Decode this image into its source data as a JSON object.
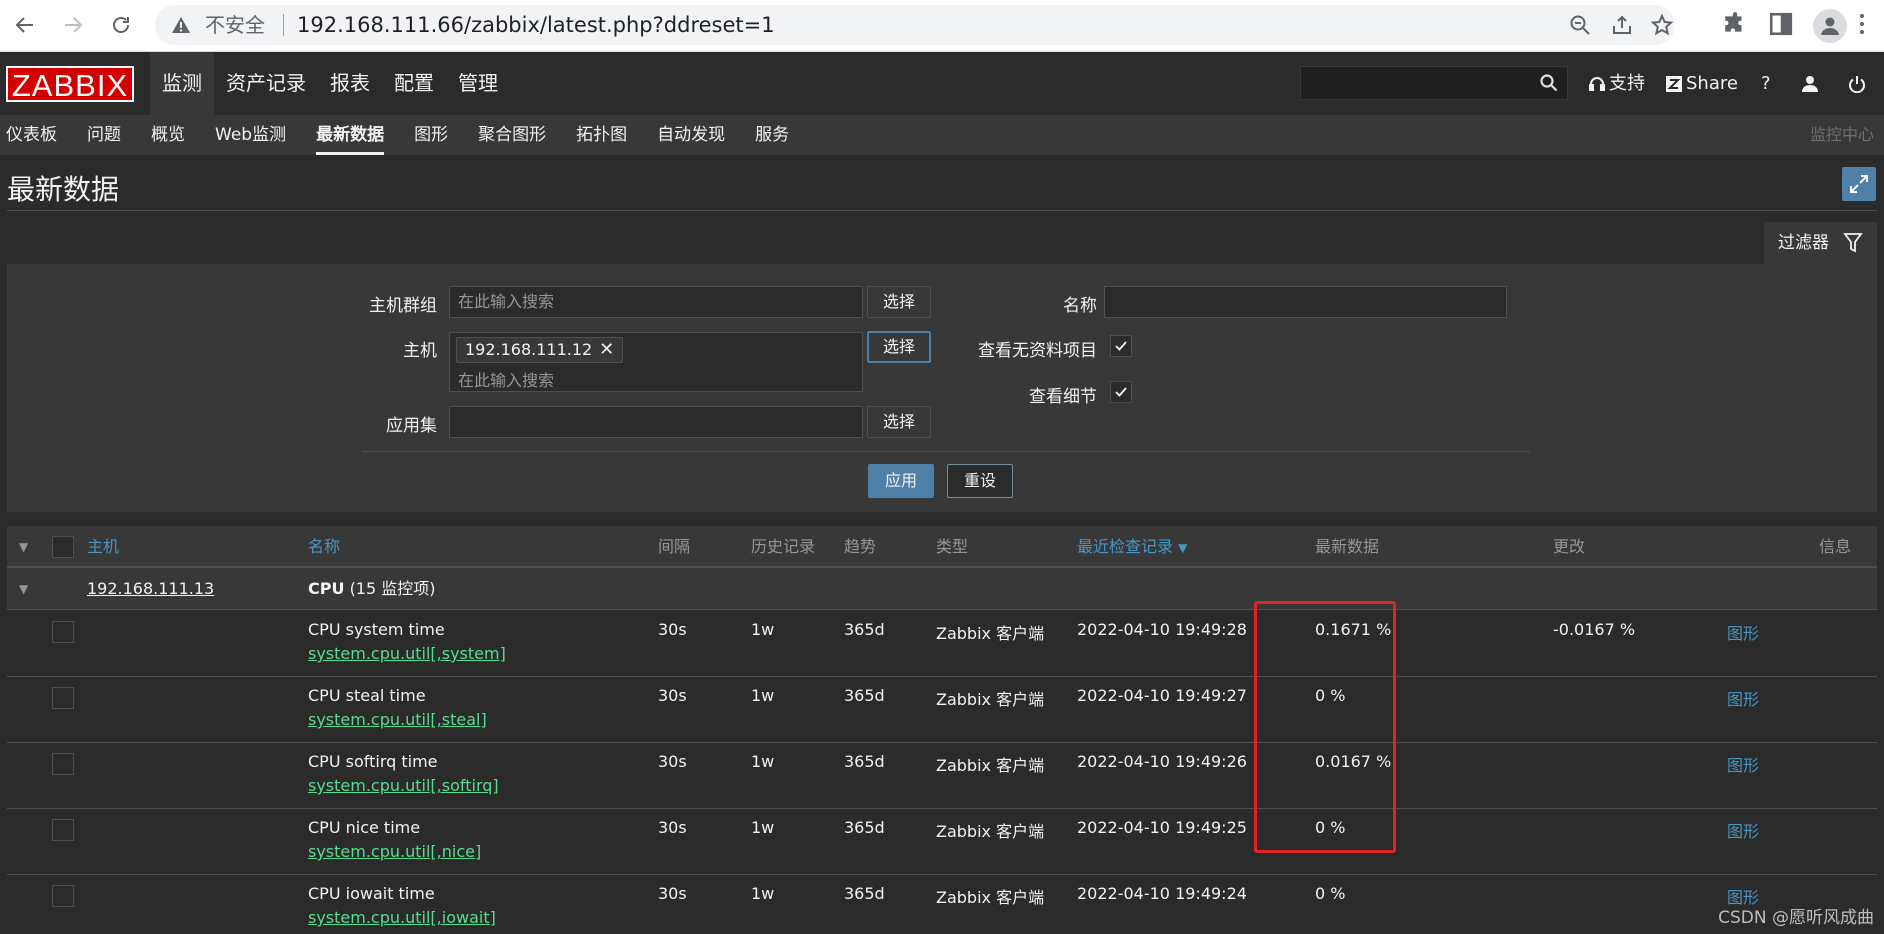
{
  "browser": {
    "insecure_label": "不安全",
    "url": "192.168.111.66/zabbix/latest.php?ddreset=1"
  },
  "topnav": {
    "logo": "ZABBIX",
    "menu": [
      {
        "label": "监测",
        "active": true
      },
      {
        "label": "资产记录"
      },
      {
        "label": "报表"
      },
      {
        "label": "配置"
      },
      {
        "label": "管理"
      }
    ],
    "support_label": "支持",
    "share_label": "Share",
    "help_label": "?"
  },
  "subnav": {
    "items": [
      {
        "label": "仪表板"
      },
      {
        "label": "问题"
      },
      {
        "label": "概览"
      },
      {
        "label": "Web监测"
      },
      {
        "label": "最新数据",
        "active": true
      },
      {
        "label": "图形"
      },
      {
        "label": "聚合图形"
      },
      {
        "label": "拓扑图"
      },
      {
        "label": "自动发现"
      },
      {
        "label": "服务"
      }
    ],
    "right_label": "监控中心"
  },
  "page": {
    "title": "最新数据"
  },
  "filter": {
    "tab_label": "过滤器",
    "host_group_label": "主机群组",
    "host_group_placeholder": "在此输入搜索",
    "host_label": "主机",
    "host_chip": "192.168.111.12",
    "host_placeholder": "在此输入搜索",
    "application_label": "应用集",
    "name_label": "名称",
    "show_no_data_label": "查看无资料项目",
    "show_details_label": "查看细节",
    "select_label": "选择",
    "apply_label": "应用",
    "reset_label": "重设"
  },
  "table": {
    "columns": {
      "host": "主机",
      "name": "名称",
      "interval": "间隔",
      "history": "历史记录",
      "trends": "趋势",
      "type": "类型",
      "last_check": "最近检查记录",
      "last_value": "最新数据",
      "change": "更改",
      "info": "信息"
    },
    "group": {
      "host": "192.168.111.13",
      "app_name": "CPU",
      "app_count": "(15 监控项)"
    },
    "rows": [
      {
        "name": "CPU system time",
        "key": "system.cpu.util[,system]",
        "interval": "30s",
        "history": "1w",
        "trends": "365d",
        "type": "Zabbix 客户端",
        "last_check": "2022-04-10 19:49:28",
        "last_value": "0.1671 %",
        "change": "-0.0167 %",
        "graph": "图形"
      },
      {
        "name": "CPU steal time",
        "key": "system.cpu.util[,steal]",
        "interval": "30s",
        "history": "1w",
        "trends": "365d",
        "type": "Zabbix 客户端",
        "last_check": "2022-04-10 19:49:27",
        "last_value": "0 %",
        "change": "",
        "graph": "图形"
      },
      {
        "name": "CPU softirq time",
        "key": "system.cpu.util[,softirq]",
        "interval": "30s",
        "history": "1w",
        "trends": "365d",
        "type": "Zabbix 客户端",
        "last_check": "2022-04-10 19:49:26",
        "last_value": "0.0167 %",
        "change": "",
        "graph": "图形"
      },
      {
        "name": "CPU nice time",
        "key": "system.cpu.util[,nice]",
        "interval": "30s",
        "history": "1w",
        "trends": "365d",
        "type": "Zabbix 客户端",
        "last_check": "2022-04-10 19:49:25",
        "last_value": "0 %",
        "change": "",
        "graph": "图形"
      },
      {
        "name": "CPU iowait time",
        "key": "system.cpu.util[,iowait]",
        "interval": "30s",
        "history": "1w",
        "trends": "365d",
        "type": "Zabbix 客户端",
        "last_check": "2022-04-10 19:49:24",
        "last_value": "0 %",
        "change": "",
        "graph": "图形"
      }
    ]
  },
  "watermark": "CSDN @愿听风成曲",
  "colors": {
    "background": "#2b2b2b",
    "panel": "#383838",
    "accent_blue": "#4f81a8",
    "link_blue": "#4796c4",
    "key_green": "#59db8f",
    "logo_red": "#d40000",
    "highlight_red": "#e02424"
  }
}
